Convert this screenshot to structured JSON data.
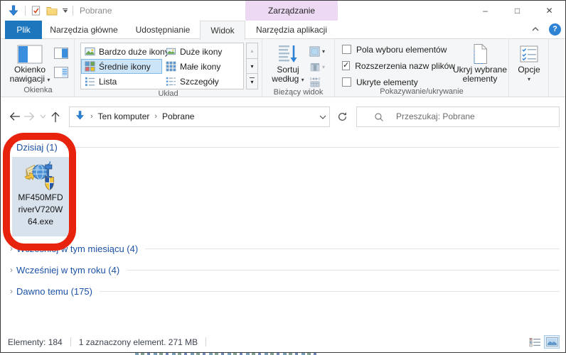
{
  "colors": {
    "accent_blue": "#1e76bd",
    "contextual_purple": "#edd9f3",
    "annotation_red": "#e8230d",
    "gallery_selection": "#cce4f7",
    "tile_selection": "#d8e2ed",
    "group_header_blue": "#1c51a5"
  },
  "icons": {
    "caret_down": "▾",
    "chevron_right": "›",
    "minimize": "–",
    "maximize": "□",
    "close": "✕",
    "help": "?",
    "scroll_up": "▴",
    "scroll_down": "▾",
    "checkmark": "✓"
  },
  "titlebar": {
    "qat_title": "Pobrane",
    "contextual_tab": "Zarządzanie"
  },
  "tabs": {
    "file": "Plik",
    "home": "Narzędzia główne",
    "share": "Udostępnianie",
    "view": "Widok",
    "app": "Narzędzia aplikacji",
    "active": "Widok"
  },
  "ribbon": {
    "panes": {
      "group_label": "Okienka",
      "nav_line1": "Okienko",
      "nav_line2": "nawigacji"
    },
    "layout": {
      "group_label": "Układ",
      "items": [
        "Bardzo duże ikony",
        "Średnie ikony",
        "Lista",
        "Duże ikony",
        "Małe ikony",
        "Szczegóły"
      ],
      "selected": "Średnie ikony"
    },
    "current_view": {
      "group_label": "Bieżący widok",
      "sort_line1": "Sortuj",
      "sort_line2": "według"
    },
    "show_hide": {
      "group_label": "Pokazywanie/ukrywanie",
      "checkboxes": [
        {
          "label": "Pola wyboru elementów",
          "checked": false,
          "mark": ""
        },
        {
          "label": "Rozszerzenia nazw plików",
          "checked": true,
          "mark": "✓"
        },
        {
          "label": "Ukryte elementy",
          "checked": false,
          "mark": ""
        }
      ],
      "hide_line1": "Ukryj wybrane",
      "hide_line2": "elementy"
    },
    "options": {
      "label": "Opcje"
    }
  },
  "navigation": {
    "crumb1": "Ten komputer",
    "crumb2": "Pobrane",
    "search_placeholder": "Przeszukaj: Pobrane"
  },
  "content": {
    "groups": [
      {
        "header": "Dzisiaj (1)",
        "expanded": true
      },
      {
        "header": "Wcześniej w tym miesiącu (4)",
        "expanded": false
      },
      {
        "header": "Wcześniej w tym roku (4)",
        "expanded": false
      },
      {
        "header": "Dawno temu (175)",
        "expanded": false
      }
    ],
    "selected_file": {
      "line1": "MF450MFD",
      "line2": "riverV720W",
      "line3": "64.exe",
      "full_name": "MF450MFDriverV720W64.exe",
      "selected": true
    }
  },
  "statusbar": {
    "items": "Elementy: 184",
    "selection": "1 zaznaczony element. 271 MB"
  },
  "annotation": {
    "type": "red-rounded-rectangle-highlight",
    "color": "#e8230d"
  }
}
